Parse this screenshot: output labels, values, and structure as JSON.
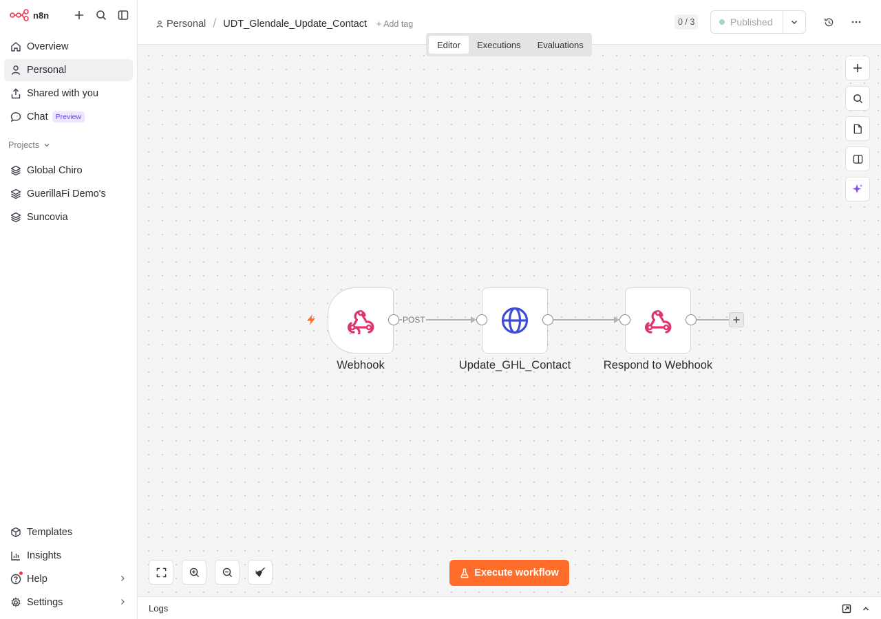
{
  "app": {
    "logo_text": "n8n"
  },
  "sidebar": {
    "nav": [
      {
        "label": "Overview",
        "icon": "home-icon"
      },
      {
        "label": "Personal",
        "icon": "user-icon"
      },
      {
        "label": "Shared with you",
        "icon": "share-icon"
      },
      {
        "label": "Chat",
        "icon": "chat-icon",
        "badge": "Preview"
      }
    ],
    "projects_header": "Projects",
    "projects": [
      {
        "label": "Global Chiro",
        "icon": "layers-icon"
      },
      {
        "label": "GuerillaFi Demo's",
        "icon": "layers-icon"
      },
      {
        "label": "Suncovia",
        "icon": "layers-icon"
      }
    ],
    "bottom": [
      {
        "label": "Templates",
        "icon": "templates-icon"
      },
      {
        "label": "Insights",
        "icon": "chart-icon"
      },
      {
        "label": "Help",
        "icon": "help-icon"
      },
      {
        "label": "Settings",
        "icon": "gear-icon"
      }
    ]
  },
  "header": {
    "project": "Personal",
    "separator": "/",
    "workflow_name": "UDT_Glendale_Update_Contact",
    "add_tag": "+ Add tag",
    "counter": "0 / 3",
    "publish_label": "Published",
    "publish_dot_color": "#9fd4c7"
  },
  "tabs": [
    {
      "label": "Editor",
      "active": true
    },
    {
      "label": "Executions",
      "active": false
    },
    {
      "label": "Evaluations",
      "active": false
    }
  ],
  "workflow": {
    "nodes": [
      {
        "name": "Webhook",
        "type": "webhook"
      },
      {
        "name": "Update_GHL_Contact",
        "type": "http-request"
      },
      {
        "name": "Respond to Webhook",
        "type": "webhook"
      }
    ],
    "connection_label": "POST"
  },
  "execute_button": "Execute workflow",
  "logs": {
    "label": "Logs"
  },
  "colors": {
    "accent": "#ff6d2b",
    "webhook": "#e0336c",
    "http": "#3b4cd8",
    "trigger_bolt": "#ff6d2b"
  }
}
